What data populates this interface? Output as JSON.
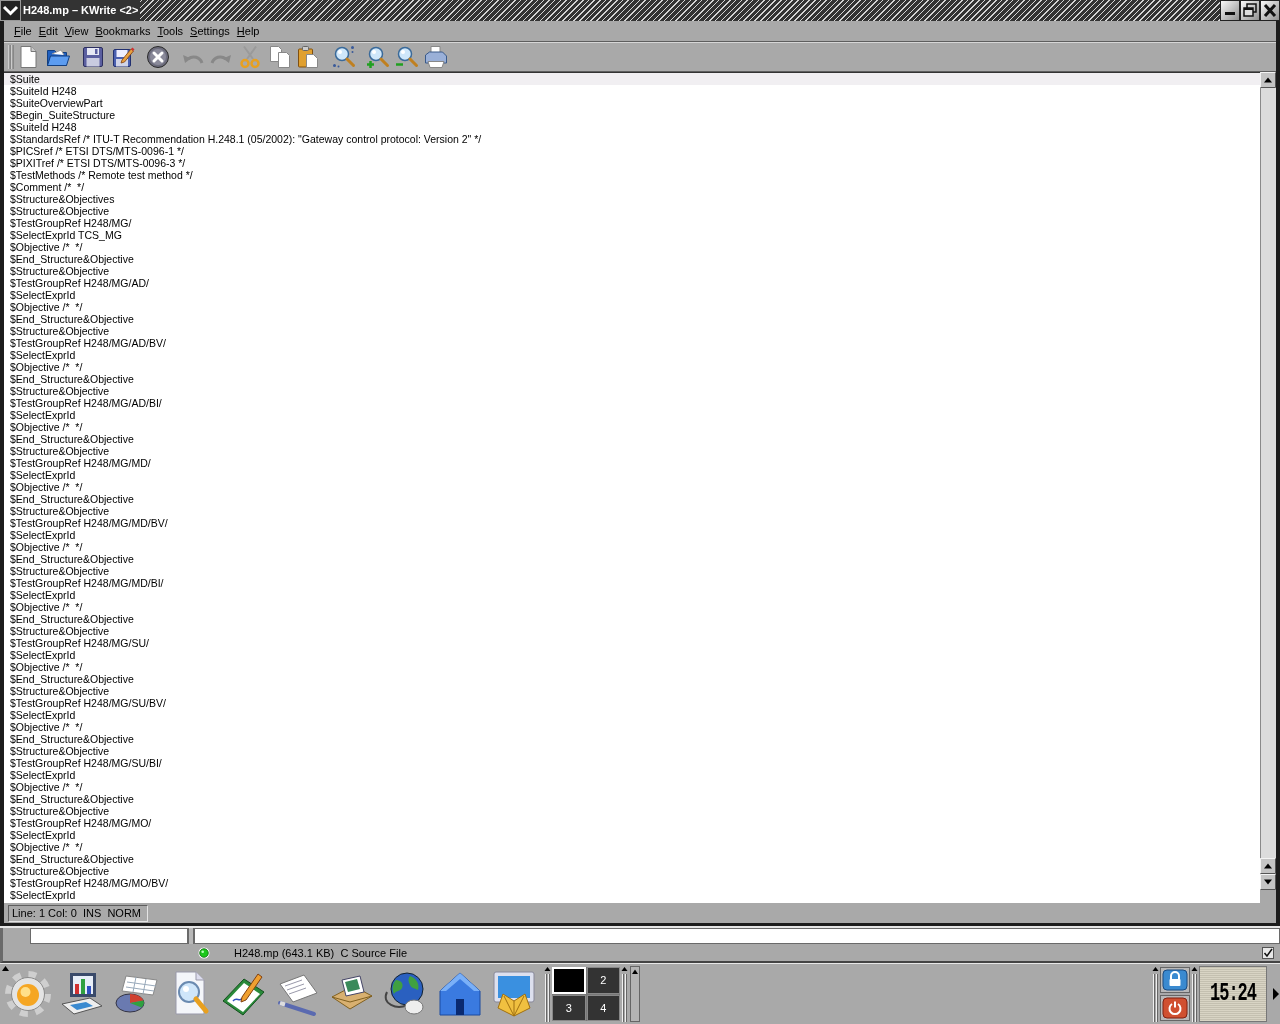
{
  "window": {
    "title": "H248.mp – KWrite <2>"
  },
  "menu": [
    "File",
    "Edit",
    "View",
    "Bookmarks",
    "Tools",
    "Settings",
    "Help"
  ],
  "toolbar": [
    {
      "disabled": false
    },
    {
      "disabled": false
    },
    {
      "disabled": false
    },
    {
      "disabled": false
    },
    {
      "disabled": false
    },
    {
      "disabled": true
    },
    {
      "disabled": true
    },
    {
      "disabled": false
    },
    {
      "disabled": false
    },
    {
      "disabled": false
    },
    {
      "disabled": false
    },
    {
      "disabled": false
    },
    {
      "disabled": false
    },
    {
      "disabled": false
    }
  ],
  "editor": {
    "lines": [
      {
        "text": "$Suite",
        "current": true
      },
      {
        "text": "$SuiteId H248",
        "current": false
      },
      {
        "text": "$SuiteOverviewPart",
        "current": false
      },
      {
        "text": "$Begin_SuiteStructure",
        "current": false
      },
      {
        "text": "$SuiteId H248",
        "current": false
      },
      {
        "text": "$StandardsRef /* ITU-T Recommendation H.248.1 (05/2002): \"Gateway control protocol: Version 2\" */",
        "current": false
      },
      {
        "text": "$PICSref /* ETSI DTS/MTS-0096-1 */",
        "current": false
      },
      {
        "text": "$PIXITref /* ETSI DTS/MTS-0096-3 */",
        "current": false
      },
      {
        "text": "$TestMethods /* Remote test method */",
        "current": false
      },
      {
        "text": "$Comment /*  */",
        "current": false
      },
      {
        "text": "$Structure&Objectives",
        "current": false
      },
      {
        "text": "$Structure&Objective",
        "current": false
      },
      {
        "text": "$TestGroupRef H248/MG/",
        "current": false
      },
      {
        "text": "$SelectExprId TCS_MG",
        "current": false
      },
      {
        "text": "$Objective /*  */",
        "current": false
      },
      {
        "text": "$End_Structure&Objective",
        "current": false
      },
      {
        "text": "$Structure&Objective",
        "current": false
      },
      {
        "text": "$TestGroupRef H248/MG/AD/",
        "current": false
      },
      {
        "text": "$SelectExprId",
        "current": false
      },
      {
        "text": "$Objective /*  */",
        "current": false
      },
      {
        "text": "$End_Structure&Objective",
        "current": false
      },
      {
        "text": "$Structure&Objective",
        "current": false
      },
      {
        "text": "$TestGroupRef H248/MG/AD/BV/",
        "current": false
      },
      {
        "text": "$SelectExprId",
        "current": false
      },
      {
        "text": "$Objective /*  */",
        "current": false
      },
      {
        "text": "$End_Structure&Objective",
        "current": false
      },
      {
        "text": "$Structure&Objective",
        "current": false
      },
      {
        "text": "$TestGroupRef H248/MG/AD/BI/",
        "current": false
      },
      {
        "text": "$SelectExprId",
        "current": false
      },
      {
        "text": "$Objective /*  */",
        "current": false
      },
      {
        "text": "$End_Structure&Objective",
        "current": false
      },
      {
        "text": "$Structure&Objective",
        "current": false
      },
      {
        "text": "$TestGroupRef H248/MG/MD/",
        "current": false
      },
      {
        "text": "$SelectExprId",
        "current": false
      },
      {
        "text": "$Objective /*  */",
        "current": false
      },
      {
        "text": "$End_Structure&Objective",
        "current": false
      },
      {
        "text": "$Structure&Objective",
        "current": false
      },
      {
        "text": "$TestGroupRef H248/MG/MD/BV/",
        "current": false
      },
      {
        "text": "$SelectExprId",
        "current": false
      },
      {
        "text": "$Objective /*  */",
        "current": false
      },
      {
        "text": "$End_Structure&Objective",
        "current": false
      },
      {
        "text": "$Structure&Objective",
        "current": false
      },
      {
        "text": "$TestGroupRef H248/MG/MD/BI/",
        "current": false
      },
      {
        "text": "$SelectExprId",
        "current": false
      },
      {
        "text": "$Objective /*  */",
        "current": false
      },
      {
        "text": "$End_Structure&Objective",
        "current": false
      },
      {
        "text": "$Structure&Objective",
        "current": false
      },
      {
        "text": "$TestGroupRef H248/MG/SU/",
        "current": false
      },
      {
        "text": "$SelectExprId",
        "current": false
      },
      {
        "text": "$Objective /*  */",
        "current": false
      },
      {
        "text": "$End_Structure&Objective",
        "current": false
      },
      {
        "text": "$Structure&Objective",
        "current": false
      },
      {
        "text": "$TestGroupRef H248/MG/SU/BV/",
        "current": false
      },
      {
        "text": "$SelectExprId",
        "current": false
      },
      {
        "text": "$Objective /*  */",
        "current": false
      },
      {
        "text": "$End_Structure&Objective",
        "current": false
      },
      {
        "text": "$Structure&Objective",
        "current": false
      },
      {
        "text": "$TestGroupRef H248/MG/SU/BI/",
        "current": false
      },
      {
        "text": "$SelectExprId",
        "current": false
      },
      {
        "text": "$Objective /*  */",
        "current": false
      },
      {
        "text": "$End_Structure&Objective",
        "current": false
      },
      {
        "text": "$Structure&Objective",
        "current": false
      },
      {
        "text": "$TestGroupRef H248/MG/MO/",
        "current": false
      },
      {
        "text": "$SelectExprId",
        "current": false
      },
      {
        "text": "$Objective /*  */",
        "current": false
      },
      {
        "text": "$End_Structure&Objective",
        "current": false
      },
      {
        "text": "$Structure&Objective",
        "current": false
      },
      {
        "text": "$TestGroupRef H248/MG/MO/BV/",
        "current": false
      },
      {
        "text": "$SelectExprId",
        "current": false
      }
    ]
  },
  "status_bar": {
    "cursor": "Line: 1 Col: 0  INS  NORM"
  },
  "background_window": {
    "status": "H248.mp (643.1 KB)  C Source File"
  },
  "taskbar": {
    "pager": [
      {
        "selected": true
      },
      {
        "label": "2",
        "selected": false
      },
      {
        "label": "3",
        "selected": false
      },
      {
        "label": "4",
        "selected": false
      }
    ],
    "clock": "15:24"
  }
}
